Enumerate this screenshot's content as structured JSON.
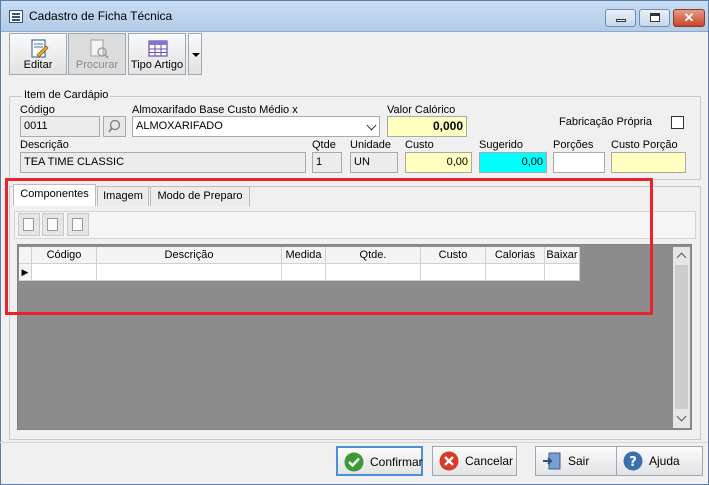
{
  "window": {
    "title": "Cadastro de Ficha Técnica",
    "close_glyph": "✕"
  },
  "toolbar": {
    "editar_label": "Editar",
    "procurar_label": "Procurar",
    "tipo_artigo_label": "Tipo Artigo"
  },
  "item": {
    "group_label": "Item de Cardápio",
    "codigo_label": "Código",
    "codigo_value": "0011",
    "almoxarifado_label": "Almoxarifado Base Custo Médio x",
    "almoxarifado_value": "ALMOXARIFADO",
    "valor_calorico_label": "Valor Calórico",
    "valor_calorico_value": "0,000",
    "fabricacao_label": "Fabricação Própria",
    "descricao_label": "Descrição",
    "descricao_value": "TEA TIME CLASSIC",
    "qtde_label": "Qtde",
    "qtde_value": "1",
    "unidade_label": "Unidade",
    "unidade_value": "UN",
    "custo_label": "Custo",
    "custo_value": "0,00",
    "sugerido_label": "Sugerido",
    "sugerido_value": "0,00",
    "porcoes_label": "Porções",
    "porcoes_value": "",
    "custo_porcao_label": "Custo Porção",
    "custo_porcao_value": ""
  },
  "tabs": [
    {
      "label": "Componentes"
    },
    {
      "label": "Imagem"
    },
    {
      "label": "Modo de Preparo"
    }
  ],
  "grid": {
    "columns": [
      "Código",
      "Descrição",
      "Medida",
      "Qtde.",
      "Custo",
      "Calorias",
      "Baixar"
    ],
    "row_indicator": "▶"
  },
  "buttons": {
    "confirmar": "Confirmar",
    "cancelar": "Cancelar",
    "sair": "Sair",
    "ajuda": "Ajuda"
  },
  "colors": {
    "highlight": "#e8232c",
    "yellow_field": "#ffffc0",
    "cyan_field": "#00ffff"
  }
}
